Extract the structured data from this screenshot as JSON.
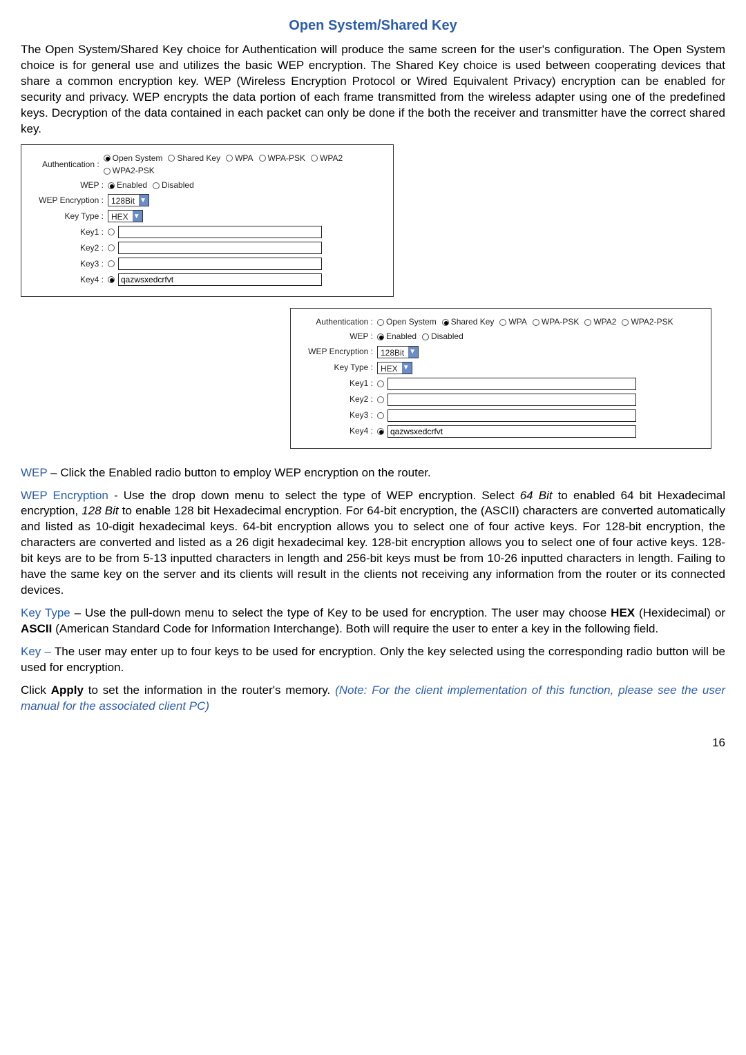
{
  "title": "Open System/Shared Key",
  "intro": "The Open System/Shared Key choice for Authentication will produce the same screen for the user's configuration. The Open System choice is for general use and utilizes the basic WEP encryption. The Shared Key choice is used between cooperating devices that share a common encryption key. WEP (Wireless Encryption Protocol or Wired Equivalent Privacy) encryption can be enabled for security and privacy. WEP encrypts the data portion of each frame transmitted from the wireless adapter using one of the predefined keys. Decryption of the data contained in each packet can only be done if the both the receiver and transmitter have the correct shared key.",
  "panel": {
    "auth_label": "Authentication :",
    "auth_opts": [
      "Open System",
      "Shared Key",
      "WPA",
      "WPA-PSK",
      "WPA2",
      "WPA2-PSK"
    ],
    "wep_label": "WEP :",
    "wep_opts": [
      "Enabled",
      "Disabled"
    ],
    "enc_label": "WEP Encryption :",
    "enc_value": "128Bit",
    "type_label": "Key Type :",
    "type_value": "HEX",
    "key1": "Key1 :",
    "key2": "Key2 :",
    "key3": "Key3 :",
    "key4": "Key4 :",
    "key4_value": "qazwsxedcrfvt"
  },
  "defs": {
    "wep_term": "WEP",
    "wep_text": " – Click the Enabled radio button to employ WEP encryption on the router.",
    "wepenc_term": "WEP Encryption",
    "wepenc_text_a": " - Use the drop down menu to select the type of WEP encryption. Select ",
    "wepenc_64": "64 Bit",
    "wepenc_text_b": " to enabled 64 bit Hexadecimal encryption, ",
    "wepenc_128": "128 Bit",
    "wepenc_text_c": " to enable 128 bit Hexadecimal encryption. For 64-bit encryption, the (ASCII) characters are converted automatically and listed as 10-digit hexadecimal keys. 64-bit encryption allows you to select one of four active keys. For 128-bit encryption, the characters are converted and listed as a 26 digit hexadecimal key. 128-bit encryption allows you to select one of four active keys. 128-bit keys are to be from 5-13 inputted characters in length and 256-bit keys must be from 10-26 inputted characters in length. Failing to have the same key on the server and its clients will result in the clients not receiving any information from the router or its connected devices.",
    "keytype_term": "Key Type",
    "keytype_text_a": " – Use the pull-down menu to select the type of Key to be used for encryption. The user may choose ",
    "keytype_hex": "HEX",
    "keytype_text_b": " (Hexidecimal) or ",
    "keytype_ascii": "ASCII",
    "keytype_text_c": " (American Standard Code for Information Interchange). Both will require the user to enter a key in the following field.",
    "key_term": "Key –",
    "key_text": " The user may enter up to four keys to be used for encryption. Only the key selected using the corresponding radio button will be used for encryption.",
    "apply_a": "Click ",
    "apply_b": "Apply",
    "apply_c": " to set the information in the router's memory. ",
    "apply_note": "(Note: For the client implementation of this function, please see the user manual for the associated client PC)"
  },
  "page_number": "16"
}
